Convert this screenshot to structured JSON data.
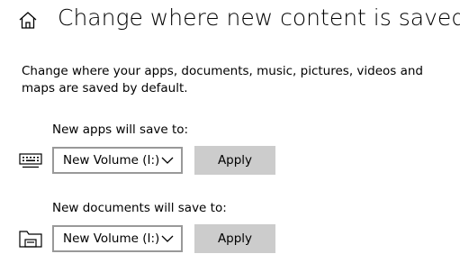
{
  "header": {
    "title": "Change where new content is saved"
  },
  "description": "Change where your apps, documents, music, pictures, videos and maps are saved by default.",
  "settings": [
    {
      "label": "New apps will save to:",
      "dropdown_value": "New Volume (I:)",
      "apply_label": "Apply",
      "icon": "keyboard-icon"
    },
    {
      "label": "New documents will save to:",
      "dropdown_value": "New Volume (I:)",
      "apply_label": "Apply",
      "icon": "folder-drive-icon"
    }
  ],
  "colors": {
    "apply_button_bg": "#cccccc",
    "dropdown_border": "#999999"
  }
}
